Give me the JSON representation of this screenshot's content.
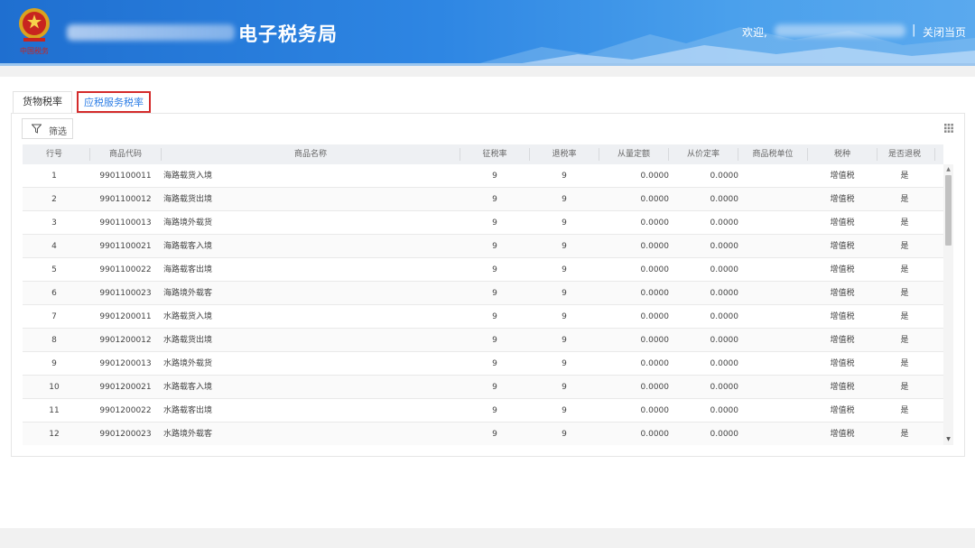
{
  "header": {
    "title": "电子税务局",
    "welcome": "欢迎,",
    "separator": "|",
    "close_label": "关闭当页",
    "emblem_caption": "中国税务"
  },
  "tabs": [
    {
      "label": "货物税率",
      "active": false
    },
    {
      "label": "应税服务税率",
      "active": true
    }
  ],
  "toolbar": {
    "filter_label": "筛选",
    "filter_icon": "funnel-icon",
    "columns_icon": "grid-icon"
  },
  "table": {
    "columns": [
      "行号",
      "商品代码",
      "商品名称",
      "征税率",
      "退税率",
      "从量定额",
      "从价定率",
      "商品税单位",
      "税种",
      "是否退税"
    ],
    "rows": [
      {
        "no": "1",
        "code": "9901100011",
        "name": "海路载货入境",
        "levy": "9",
        "refund": "9",
        "quantity": "0.0000",
        "value": "0.0000",
        "unit": "",
        "tax": "增值税",
        "refundable": "是"
      },
      {
        "no": "2",
        "code": "9901100012",
        "name": "海路载货出境",
        "levy": "9",
        "refund": "9",
        "quantity": "0.0000",
        "value": "0.0000",
        "unit": "",
        "tax": "增值税",
        "refundable": "是"
      },
      {
        "no": "3",
        "code": "9901100013",
        "name": "海路境外载货",
        "levy": "9",
        "refund": "9",
        "quantity": "0.0000",
        "value": "0.0000",
        "unit": "",
        "tax": "增值税",
        "refundable": "是"
      },
      {
        "no": "4",
        "code": "9901100021",
        "name": "海路载客入境",
        "levy": "9",
        "refund": "9",
        "quantity": "0.0000",
        "value": "0.0000",
        "unit": "",
        "tax": "增值税",
        "refundable": "是"
      },
      {
        "no": "5",
        "code": "9901100022",
        "name": "海路载客出境",
        "levy": "9",
        "refund": "9",
        "quantity": "0.0000",
        "value": "0.0000",
        "unit": "",
        "tax": "增值税",
        "refundable": "是"
      },
      {
        "no": "6",
        "code": "9901100023",
        "name": "海路境外载客",
        "levy": "9",
        "refund": "9",
        "quantity": "0.0000",
        "value": "0.0000",
        "unit": "",
        "tax": "增值税",
        "refundable": "是"
      },
      {
        "no": "7",
        "code": "9901200011",
        "name": "水路载货入境",
        "levy": "9",
        "refund": "9",
        "quantity": "0.0000",
        "value": "0.0000",
        "unit": "",
        "tax": "增值税",
        "refundable": "是"
      },
      {
        "no": "8",
        "code": "9901200012",
        "name": "水路载货出境",
        "levy": "9",
        "refund": "9",
        "quantity": "0.0000",
        "value": "0.0000",
        "unit": "",
        "tax": "增值税",
        "refundable": "是"
      },
      {
        "no": "9",
        "code": "9901200013",
        "name": "水路境外载货",
        "levy": "9",
        "refund": "9",
        "quantity": "0.0000",
        "value": "0.0000",
        "unit": "",
        "tax": "增值税",
        "refundable": "是"
      },
      {
        "no": "10",
        "code": "9901200021",
        "name": "水路载客入境",
        "levy": "9",
        "refund": "9",
        "quantity": "0.0000",
        "value": "0.0000",
        "unit": "",
        "tax": "增值税",
        "refundable": "是"
      },
      {
        "no": "11",
        "code": "9901200022",
        "name": "水路载客出境",
        "levy": "9",
        "refund": "9",
        "quantity": "0.0000",
        "value": "0.0000",
        "unit": "",
        "tax": "增值税",
        "refundable": "是"
      },
      {
        "no": "12",
        "code": "9901200023",
        "name": "水路境外载客",
        "levy": "9",
        "refund": "9",
        "quantity": "0.0000",
        "value": "0.0000",
        "unit": "",
        "tax": "增值税",
        "refundable": "是"
      }
    ]
  },
  "scrollbar": {
    "up_glyph": "▲",
    "down_glyph": "▼"
  },
  "colors": {
    "header_start": "#1f6fd0",
    "header_end": "#5aa9ee",
    "active_tab_text": "#2f7fe6",
    "active_tab_border": "#d42b2b"
  }
}
